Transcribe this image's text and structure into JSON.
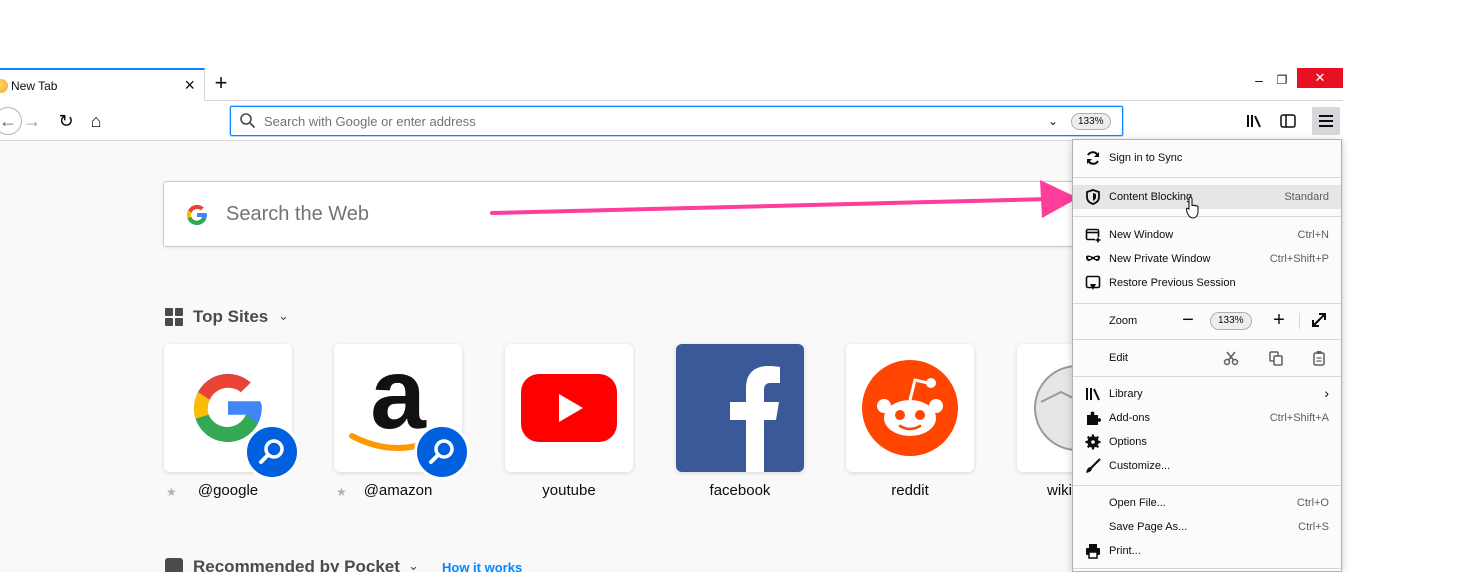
{
  "tab": {
    "title": "New Tab",
    "close": "×",
    "new_tab": "+"
  },
  "window_controls": {
    "minimize": "–",
    "restore": "❐",
    "close": "✕"
  },
  "nav": {
    "back": "←",
    "forward": "→",
    "reload": "↻",
    "home": "⌂"
  },
  "urlbar": {
    "placeholder": "Search with Google or enter address",
    "dropdown": "⌄",
    "zoom": "133%"
  },
  "search": {
    "placeholder": "Search the Web"
  },
  "top_sites": {
    "title": "Top Sites",
    "chevron": "⌄",
    "items": [
      {
        "label": "@google",
        "pinned": true
      },
      {
        "label": "@amazon",
        "pinned": true
      },
      {
        "label": "youtube",
        "pinned": false
      },
      {
        "label": "facebook",
        "pinned": false
      },
      {
        "label": "reddit",
        "pinned": false
      },
      {
        "label": "wiki",
        "pinned": false
      }
    ]
  },
  "pocket": {
    "title": "Recommended by Pocket",
    "chevron": "⌄",
    "link": "How it works"
  },
  "app_menu": {
    "sign_in": "Sign in to Sync",
    "content_blocking": {
      "label": "Content Blocking",
      "value": "Standard"
    },
    "new_window": {
      "label": "New Window",
      "shortcut": "Ctrl+N"
    },
    "new_private_window": {
      "label": "New Private Window",
      "shortcut": "Ctrl+Shift+P"
    },
    "restore_session": "Restore Previous Session",
    "zoom": {
      "label": "Zoom",
      "minus": "−",
      "value": "133%",
      "plus": "+"
    },
    "edit": "Edit",
    "library": {
      "label": "Library",
      "chevron": "›"
    },
    "addons": {
      "label": "Add-ons",
      "shortcut": "Ctrl+Shift+A"
    },
    "options": "Options",
    "customize": "Customize...",
    "open_file": {
      "label": "Open File...",
      "shortcut": "Ctrl+O"
    },
    "save_page": {
      "label": "Save Page As...",
      "shortcut": "Ctrl+S"
    },
    "print": "Print..."
  },
  "colors": {
    "accent": "#0a84ff",
    "annotation": "#ff3d9a",
    "close": "#e81123"
  },
  "icons": [
    "search-icon",
    "sync-icon",
    "shield-icon",
    "new-window-icon",
    "mask-icon",
    "restore-icon",
    "fullscreen-icon",
    "cut-icon",
    "copy-icon",
    "paste-icon",
    "library-icon",
    "puzzle-icon",
    "gear-icon",
    "brush-icon",
    "printer-icon",
    "hamburger-icon"
  ]
}
